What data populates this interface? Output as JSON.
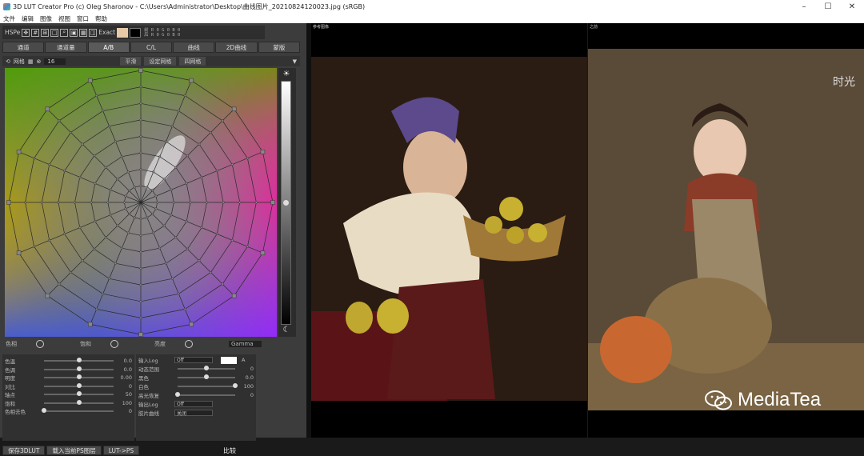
{
  "window": {
    "title": "3D LUT Creator Pro (c) Oleg Sharonov - C:\\Users\\Administrator\\Desktop\\曲线图片_20210824120023.jpg (sRGB)",
    "controls": [
      "–",
      "☐",
      "✕"
    ]
  },
  "menu": [
    "文件",
    "编辑",
    "图像",
    "视图",
    "窗口",
    "帮助"
  ],
  "toolbar": {
    "mode": "HSPe",
    "exact": "Exact",
    "swatch_before": "#e8c9a8",
    "swatch_after": "#000000",
    "readout_rows": [
      "前 R 0 G 0 B 0",
      "后 R 0 G 0 B 0"
    ]
  },
  "tabs": [
    "通道",
    "通道量",
    "A/B",
    "C/L",
    "曲线",
    "2D曲线",
    "蒙版"
  ],
  "options": {
    "grid": "网格",
    "grid_value": "16",
    "btn1": "平滑",
    "btn2": "设定网格",
    "btn3": "四网格"
  },
  "channel_row": {
    "hue": "色相",
    "sat": "饱和",
    "lum": "亮度",
    "gamma": "Gamma"
  },
  "left_controls": [
    {
      "label": "色温",
      "value": "0.0",
      "pos": 0.5
    },
    {
      "label": "色调",
      "value": "0.0",
      "pos": 0.5
    },
    {
      "label": "明度",
      "value": "0.00",
      "pos": 0.5
    },
    {
      "label": "对比",
      "value": "0",
      "pos": 0.5
    },
    {
      "label": "轴点",
      "value": "50",
      "pos": 0.5
    },
    {
      "label": "饱和",
      "value": "100",
      "pos": 0.5
    },
    {
      "label": "色相去色",
      "value": "0",
      "pos": 0.0
    }
  ],
  "right_controls": {
    "input_log": {
      "label": "输入Log",
      "value": "Off"
    },
    "dynamic": {
      "label": "动态范围",
      "value": "0",
      "pos": 0.5
    },
    "black": {
      "label": "黑色",
      "value": "0.0",
      "pos": 0.5
    },
    "white": {
      "label": "白色",
      "value": "100",
      "pos": 1.0
    },
    "highlight": {
      "label": "高光恢复",
      "value": "0",
      "pos": 0.0
    },
    "output_log": {
      "label": "输出Log",
      "value": "Off"
    },
    "film": {
      "label": "胶片曲线",
      "value": "关闭"
    }
  },
  "bottom_buttons": [
    "保存3DLUT",
    "载入当前PS图层",
    "LUT->PS",
    "比较"
  ],
  "panels": {
    "left_label": "参考图像",
    "right_label": "之前"
  },
  "watermark": {
    "text": "MediaTea"
  },
  "colors": {
    "panel_bg": "#3c3c3c",
    "toolbar_bg": "#2e2e2e"
  }
}
